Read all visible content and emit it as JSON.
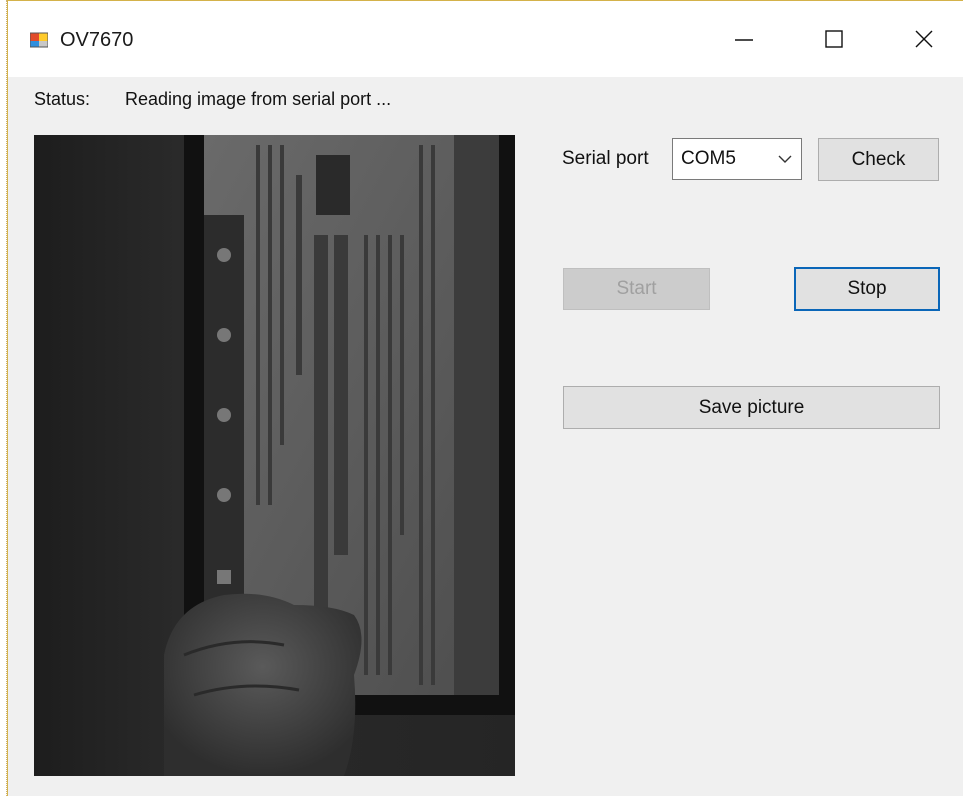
{
  "window": {
    "title": "OV7670",
    "app_icon": "winforms-app-icon",
    "controls": {
      "minimize_icon": "minimize-icon",
      "maximize_icon": "maximize-icon",
      "close_icon": "close-icon"
    }
  },
  "status": {
    "label": "Status:",
    "text": "Reading image from serial port ..."
  },
  "serial": {
    "label": "Serial port",
    "selected_port": "COM5",
    "check_label": "Check"
  },
  "actions": {
    "start_label": "Start",
    "start_enabled": false,
    "stop_label": "Stop",
    "save_label": "Save picture"
  },
  "colors": {
    "window_bg": "#f0f0f0",
    "focus_border": "#0a66b8"
  }
}
